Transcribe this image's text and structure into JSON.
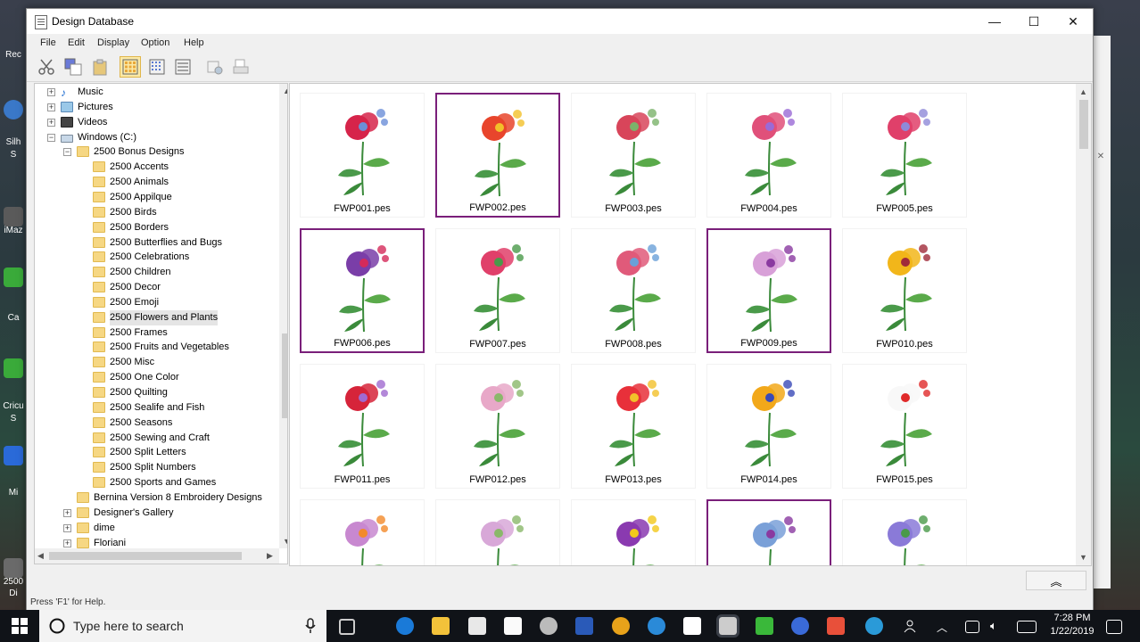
{
  "window": {
    "title": "Design Database",
    "controls": {
      "minimize": "—",
      "maximize": "☐",
      "close": "✕"
    }
  },
  "menu": [
    "File",
    "Edit",
    "Display",
    "Option",
    "Help"
  ],
  "tree": {
    "items": [
      {
        "label": "Music",
        "level": 1,
        "expander": "+",
        "icon": "music-icon"
      },
      {
        "label": "Pictures",
        "level": 1,
        "expander": "+",
        "icon": "pictures-icon"
      },
      {
        "label": "Videos",
        "level": 1,
        "expander": "+",
        "icon": "videos-icon"
      },
      {
        "label": "Windows (C:)",
        "level": 1,
        "expander": "−",
        "icon": "drive-icon"
      },
      {
        "label": "2500 Bonus Designs",
        "level": 2,
        "expander": "−",
        "icon": "folder-icon"
      },
      {
        "label": "2500 Accents",
        "level": 3,
        "icon": "folder-icon"
      },
      {
        "label": "2500 Animals",
        "level": 3,
        "icon": "folder-icon"
      },
      {
        "label": "2500 Appilque",
        "level": 3,
        "icon": "folder-icon"
      },
      {
        "label": "2500 Birds",
        "level": 3,
        "icon": "folder-icon"
      },
      {
        "label": "2500 Borders",
        "level": 3,
        "icon": "folder-icon"
      },
      {
        "label": "2500 Butterflies and Bugs",
        "level": 3,
        "icon": "folder-icon"
      },
      {
        "label": "2500 Celebrations",
        "level": 3,
        "icon": "folder-icon"
      },
      {
        "label": "2500 Children",
        "level": 3,
        "icon": "folder-icon"
      },
      {
        "label": "2500 Decor",
        "level": 3,
        "icon": "folder-icon"
      },
      {
        "label": "2500 Emoji",
        "level": 3,
        "icon": "folder-icon"
      },
      {
        "label": "2500 Flowers and Plants",
        "level": 3,
        "icon": "folder-icon",
        "selected": true
      },
      {
        "label": "2500 Frames",
        "level": 3,
        "icon": "folder-icon"
      },
      {
        "label": "2500 Fruits and Vegetables",
        "level": 3,
        "icon": "folder-icon"
      },
      {
        "label": "2500 Misc",
        "level": 3,
        "icon": "folder-icon"
      },
      {
        "label": "2500 One Color",
        "level": 3,
        "icon": "folder-icon"
      },
      {
        "label": "2500 Quilting",
        "level": 3,
        "icon": "folder-icon"
      },
      {
        "label": "2500 Sealife and Fish",
        "level": 3,
        "icon": "folder-icon"
      },
      {
        "label": "2500 Seasons",
        "level": 3,
        "icon": "folder-icon"
      },
      {
        "label": "2500 Sewing and Craft",
        "level": 3,
        "icon": "folder-icon"
      },
      {
        "label": "2500 Split Letters",
        "level": 3,
        "icon": "folder-icon"
      },
      {
        "label": "2500 Split Numbers",
        "level": 3,
        "icon": "folder-icon"
      },
      {
        "label": "2500 Sports and Games",
        "level": 3,
        "icon": "folder-icon"
      },
      {
        "label": "Bernina Version 8 Embroidery Designs",
        "level": 2,
        "icon": "folder-icon"
      },
      {
        "label": "Designer's Gallery",
        "level": 2,
        "expander": "+",
        "icon": "folder-icon"
      },
      {
        "label": "dime",
        "level": 2,
        "expander": "+",
        "icon": "folder-icon"
      },
      {
        "label": "Floriani",
        "level": 2,
        "expander": "+",
        "icon": "folder-icon"
      }
    ]
  },
  "designs": [
    {
      "name": "FWP001.pes",
      "selected": false,
      "petal": "#d6244a",
      "accent": "#6c8fd8"
    },
    {
      "name": "FWP002.pes",
      "selected": true,
      "petal": "#e8452c",
      "accent": "#f2c02a"
    },
    {
      "name": "FWP003.pes",
      "selected": false,
      "petal": "#d8455a",
      "accent": "#7bb36a"
    },
    {
      "name": "FWP004.pes",
      "selected": false,
      "petal": "#e0507a",
      "accent": "#9a6ad6"
    },
    {
      "name": "FWP005.pes",
      "selected": false,
      "petal": "#e0406a",
      "accent": "#8e8ad8"
    },
    {
      "name": "FWP006.pes",
      "selected": true,
      "petal": "#7a3ea8",
      "accent": "#d42a5a"
    },
    {
      "name": "FWP007.pes",
      "selected": false,
      "petal": "#e0406a",
      "accent": "#4a9a4a"
    },
    {
      "name": "FWP008.pes",
      "selected": false,
      "petal": "#e05a7a",
      "accent": "#6aa0d8"
    },
    {
      "name": "FWP009.pes",
      "selected": true,
      "petal": "#d8a0d8",
      "accent": "#8a3aa0"
    },
    {
      "name": "FWP010.pes",
      "selected": false,
      "petal": "#f2b61a",
      "accent": "#a02a3a"
    },
    {
      "name": "FWP011.pes",
      "selected": false,
      "petal": "#d6243a",
      "accent": "#a06ad0"
    },
    {
      "name": "FWP012.pes",
      "selected": false,
      "petal": "#e8a8c8",
      "accent": "#8ab86a"
    },
    {
      "name": "FWP013.pes",
      "selected": false,
      "petal": "#e8303a",
      "accent": "#f2c02a"
    },
    {
      "name": "FWP014.pes",
      "selected": false,
      "petal": "#f2a81a",
      "accent": "#3a4ab8"
    },
    {
      "name": "FWP015.pes",
      "selected": false,
      "petal": "#f8f8f8",
      "accent": "#e02a2a"
    },
    {
      "name": "",
      "selected": false,
      "petal": "#c888d0",
      "accent": "#f28a2a"
    },
    {
      "name": "",
      "selected": false,
      "petal": "#d8a8d8",
      "accent": "#8ab86a"
    },
    {
      "name": "",
      "selected": false,
      "petal": "#8a3ab0",
      "accent": "#f2c81a"
    },
    {
      "name": "",
      "selected": true,
      "petal": "#7aa0d8",
      "accent": "#8a3aa0"
    },
    {
      "name": "",
      "selected": false,
      "petal": "#8a7ad8",
      "accent": "#4a9a4a"
    }
  ],
  "status": "Press 'F1' for Help.",
  "taskbar": {
    "search_placeholder": "Type here to search",
    "time": "7:28 PM",
    "date": "1/22/2019"
  },
  "desktop_labels": [
    "Rec",
    "Silh",
    "S",
    "iMaz",
    "Ca",
    "Cricu",
    "S",
    "Mi",
    "2500",
    "Di"
  ]
}
